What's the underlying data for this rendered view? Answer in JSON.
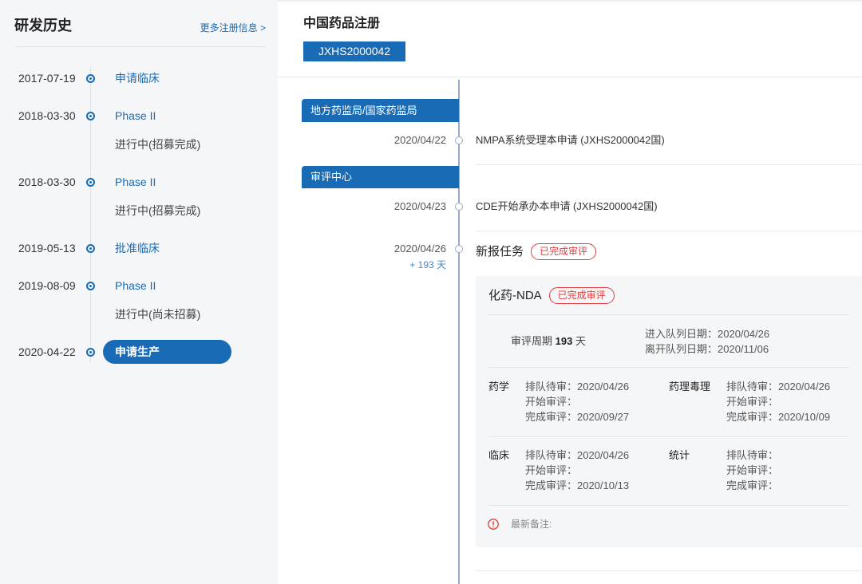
{
  "colors": {
    "accent": "#1a6bb5",
    "badge_red": "#e23b3b",
    "timeline_line": "#97abc7",
    "panel_bg": "#f5f6f8",
    "elapsed": "#4a86c5",
    "note_icon": "#e23b3b"
  },
  "icons": {
    "history_dot": "timeline-dot-icon",
    "entry_node": "timeline-node-icon",
    "note": "exclamation-circle-icon"
  },
  "history": {
    "title": "研发历史",
    "more_link": "更多注册信息 >",
    "events": [
      {
        "date": "2017-07-19",
        "label": "申请临床"
      },
      {
        "date": "2018-03-30",
        "label": "Phase II",
        "status": "进行中(招募完成)"
      },
      {
        "date": "2018-03-30",
        "label": "Phase II",
        "status": "进行中(招募完成)"
      },
      {
        "date": "2019-05-13",
        "label": "批准临床"
      },
      {
        "date": "2019-08-09",
        "label": "Phase II",
        "status": "进行中(尚未招募)"
      },
      {
        "date": "2020-04-22",
        "label": "申请生产",
        "selected": true
      }
    ]
  },
  "registration": {
    "title": "中国药品注册",
    "tabs": [
      {
        "label": "JXHS2000042",
        "active": true
      }
    ],
    "sections": [
      {
        "header": "地方药监局/国家药监局",
        "entries": [
          {
            "date": "2020/04/22",
            "text": "NMPA系统受理本申请 (JXHS2000042国)"
          }
        ]
      },
      {
        "header": "审评中心",
        "entries": [
          {
            "date": "2020/04/23",
            "text": "CDE开始承办本申请 (JXHS2000042国)"
          },
          {
            "date": "2020/04/26",
            "elapsed": "+ 193 天",
            "text": "新报任务",
            "badge": "已完成审评",
            "task": {
              "name": "化药-NDA",
              "badge": "已完成审评",
              "cycle_label": "审评周期",
              "cycle_days": 193,
              "cycle_unit": "天",
              "queue_in_label": "进入队列日期：",
              "queue_in_date": "2020/04/26",
              "queue_out_label": "离开队列日期：",
              "queue_out_date": "2020/11/06",
              "field_labels": {
                "queued": "排队待审：",
                "started": "开始审评：",
                "completed": "完成审评："
              },
              "disciplines": [
                {
                  "name": "药学",
                  "queued": "2020/04/26",
                  "started": "",
                  "completed": "2020/09/27"
                },
                {
                  "name": "药理毒理",
                  "queued": "2020/04/26",
                  "started": "",
                  "completed": "2020/10/09"
                },
                {
                  "name": "临床",
                  "queued": "2020/04/26",
                  "started": "",
                  "completed": "2020/10/13"
                },
                {
                  "name": "统计",
                  "queued": "",
                  "started": "",
                  "completed": ""
                }
              ],
              "note_label": "最新备注:"
            }
          }
        ]
      }
    ]
  }
}
